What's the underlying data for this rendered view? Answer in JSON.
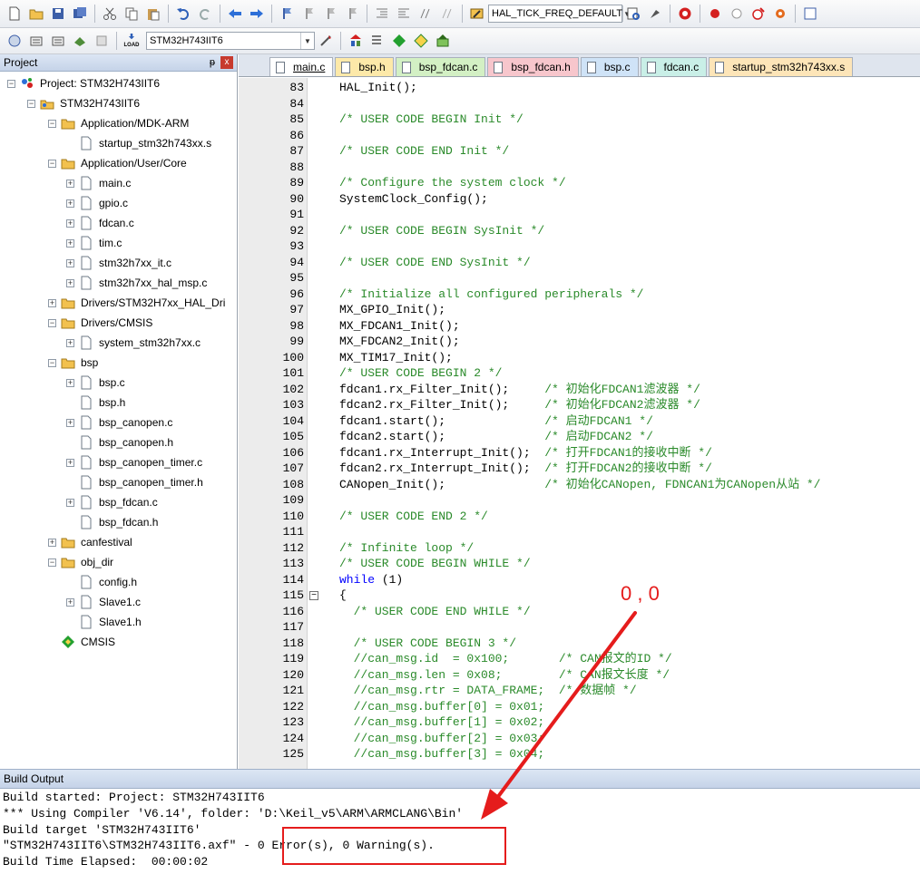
{
  "toolbar": {
    "macro": "HAL_TICK_FREQ_DEFAULT",
    "target": "STM32H743IIT6",
    "load_label": "LOAD"
  },
  "project_panel": {
    "title": "Project",
    "pin": "ᵽ",
    "close": "x",
    "items": [
      {
        "label": "Project: STM32H743IIT6",
        "level": 0,
        "icon": "project-icon",
        "expand": "−"
      },
      {
        "label": "STM32H743IIT6",
        "level": 1,
        "icon": "target-icon",
        "expand": "−"
      },
      {
        "label": "Application/MDK-ARM",
        "level": 2,
        "icon": "folder-icon",
        "expand": "−"
      },
      {
        "label": "startup_stm32h743xx.s",
        "level": 3,
        "icon": "file-icon",
        "expand": ""
      },
      {
        "label": "Application/User/Core",
        "level": 2,
        "icon": "folder-icon",
        "expand": "−"
      },
      {
        "label": "main.c",
        "level": 3,
        "icon": "file-icon",
        "expand": "+"
      },
      {
        "label": "gpio.c",
        "level": 3,
        "icon": "file-icon",
        "expand": "+"
      },
      {
        "label": "fdcan.c",
        "level": 3,
        "icon": "file-icon",
        "expand": "+"
      },
      {
        "label": "tim.c",
        "level": 3,
        "icon": "file-icon",
        "expand": "+"
      },
      {
        "label": "stm32h7xx_it.c",
        "level": 3,
        "icon": "file-icon",
        "expand": "+"
      },
      {
        "label": "stm32h7xx_hal_msp.c",
        "level": 3,
        "icon": "file-icon",
        "expand": "+"
      },
      {
        "label": "Drivers/STM32H7xx_HAL_Dri",
        "level": 2,
        "icon": "folder-icon",
        "expand": "+"
      },
      {
        "label": "Drivers/CMSIS",
        "level": 2,
        "icon": "folder-icon",
        "expand": "−"
      },
      {
        "label": "system_stm32h7xx.c",
        "level": 3,
        "icon": "file-icon",
        "expand": "+"
      },
      {
        "label": "bsp",
        "level": 2,
        "icon": "folder-icon",
        "expand": "−"
      },
      {
        "label": "bsp.c",
        "level": 3,
        "icon": "file-icon",
        "expand": "+"
      },
      {
        "label": "bsp.h",
        "level": 3,
        "icon": "file-icon",
        "expand": ""
      },
      {
        "label": "bsp_canopen.c",
        "level": 3,
        "icon": "file-icon",
        "expand": "+"
      },
      {
        "label": "bsp_canopen.h",
        "level": 3,
        "icon": "file-icon",
        "expand": ""
      },
      {
        "label": "bsp_canopen_timer.c",
        "level": 3,
        "icon": "file-icon",
        "expand": "+"
      },
      {
        "label": "bsp_canopen_timer.h",
        "level": 3,
        "icon": "file-icon",
        "expand": ""
      },
      {
        "label": "bsp_fdcan.c",
        "level": 3,
        "icon": "file-icon",
        "expand": "+"
      },
      {
        "label": "bsp_fdcan.h",
        "level": 3,
        "icon": "file-icon",
        "expand": ""
      },
      {
        "label": "canfestival",
        "level": 2,
        "icon": "folder-icon",
        "expand": "+"
      },
      {
        "label": "obj_dir",
        "level": 2,
        "icon": "folder-icon",
        "expand": "−"
      },
      {
        "label": "config.h",
        "level": 3,
        "icon": "file-icon",
        "expand": ""
      },
      {
        "label": "Slave1.c",
        "level": 3,
        "icon": "file-icon",
        "expand": "+"
      },
      {
        "label": "Slave1.h",
        "level": 3,
        "icon": "file-icon",
        "expand": ""
      },
      {
        "label": "CMSIS",
        "level": 2,
        "icon": "cmsis-icon",
        "expand": ""
      }
    ]
  },
  "tabs": [
    {
      "label": "main.c",
      "active": true,
      "color": "#ffffff"
    },
    {
      "label": "bsp.h",
      "active": false,
      "color": "#fde9a9"
    },
    {
      "label": "bsp_fdcan.c",
      "active": false,
      "color": "#d3f0c4"
    },
    {
      "label": "bsp_fdcan.h",
      "active": false,
      "color": "#f7c6cc"
    },
    {
      "label": "bsp.c",
      "active": false,
      "color": "#cfe3f7"
    },
    {
      "label": "fdcan.c",
      "active": false,
      "color": "#c9efe7"
    },
    {
      "label": "startup_stm32h743xx.s",
      "active": false,
      "color": "#fde5b8"
    }
  ],
  "code_lines": [
    {
      "n": "83",
      "parts": [
        [
          "",
          "HAL_Init();"
        ]
      ]
    },
    {
      "n": "84",
      "parts": []
    },
    {
      "n": "85",
      "parts": [
        [
          "cmt",
          "/* USER CODE BEGIN Init */"
        ]
      ]
    },
    {
      "n": "86",
      "parts": []
    },
    {
      "n": "87",
      "parts": [
        [
          "cmt",
          "/* USER CODE END Init */"
        ]
      ]
    },
    {
      "n": "88",
      "parts": []
    },
    {
      "n": "89",
      "parts": [
        [
          "cmt",
          "/* Configure the system clock */"
        ]
      ]
    },
    {
      "n": "90",
      "parts": [
        [
          "",
          "SystemClock_Config();"
        ]
      ]
    },
    {
      "n": "91",
      "parts": []
    },
    {
      "n": "92",
      "parts": [
        [
          "cmt",
          "/* USER CODE BEGIN SysInit */"
        ]
      ]
    },
    {
      "n": "93",
      "parts": []
    },
    {
      "n": "94",
      "parts": [
        [
          "cmt",
          "/* USER CODE END SysInit */"
        ]
      ]
    },
    {
      "n": "95",
      "parts": []
    },
    {
      "n": "96",
      "parts": [
        [
          "cmt",
          "/* Initialize all configured peripherals */"
        ]
      ]
    },
    {
      "n": "97",
      "parts": [
        [
          "",
          "MX_GPIO_Init();"
        ]
      ]
    },
    {
      "n": "98",
      "parts": [
        [
          "",
          "MX_FDCAN1_Init();"
        ]
      ]
    },
    {
      "n": "99",
      "parts": [
        [
          "",
          "MX_FDCAN2_Init();"
        ]
      ]
    },
    {
      "n": "100",
      "parts": [
        [
          "",
          "MX_TIM17_Init();"
        ]
      ]
    },
    {
      "n": "101",
      "parts": [
        [
          "cmt",
          "/* USER CODE BEGIN 2 */"
        ]
      ]
    },
    {
      "n": "102",
      "parts": [
        [
          "",
          "fdcan1.rx_Filter_Init();     "
        ],
        [
          "cmt",
          "/* 初始化FDCAN1滤波器 */"
        ]
      ]
    },
    {
      "n": "103",
      "parts": [
        [
          "",
          "fdcan2.rx_Filter_Init();     "
        ],
        [
          "cmt",
          "/* 初始化FDCAN2滤波器 */"
        ]
      ]
    },
    {
      "n": "104",
      "parts": [
        [
          "",
          "fdcan1.start();              "
        ],
        [
          "cmt",
          "/* 启动FDCAN1 */"
        ]
      ]
    },
    {
      "n": "105",
      "parts": [
        [
          "",
          "fdcan2.start();              "
        ],
        [
          "cmt",
          "/* 启动FDCAN2 */"
        ]
      ]
    },
    {
      "n": "106",
      "parts": [
        [
          "",
          "fdcan1.rx_Interrupt_Init();  "
        ],
        [
          "cmt",
          "/* 打开FDCAN1的接收中断 */"
        ]
      ]
    },
    {
      "n": "107",
      "parts": [
        [
          "",
          "fdcan2.rx_Interrupt_Init();  "
        ],
        [
          "cmt",
          "/* 打开FDCAN2的接收中断 */"
        ]
      ]
    },
    {
      "n": "108",
      "parts": [
        [
          "",
          "CANopen_Init();              "
        ],
        [
          "cmt",
          "/* 初始化CANopen, FDNCAN1为CANopen从站 */"
        ]
      ]
    },
    {
      "n": "109",
      "parts": []
    },
    {
      "n": "110",
      "parts": [
        [
          "cmt",
          "/* USER CODE END 2 */"
        ]
      ]
    },
    {
      "n": "111",
      "parts": []
    },
    {
      "n": "112",
      "parts": [
        [
          "cmt",
          "/* Infinite loop */"
        ]
      ]
    },
    {
      "n": "113",
      "parts": [
        [
          "cmt",
          "/* USER CODE BEGIN WHILE */"
        ]
      ]
    },
    {
      "n": "114",
      "parts": [
        [
          "kw",
          "while"
        ],
        [
          "",
          " (1)"
        ]
      ]
    },
    {
      "n": "115",
      "parts": [
        [
          "",
          "{"
        ]
      ],
      "fold": "−"
    },
    {
      "n": "116",
      "parts": [
        [
          "cmt",
          "  /* USER CODE END WHILE */"
        ]
      ]
    },
    {
      "n": "117",
      "parts": []
    },
    {
      "n": "118",
      "parts": [
        [
          "cmt",
          "  /* USER CODE BEGIN 3 */"
        ]
      ]
    },
    {
      "n": "119",
      "parts": [
        [
          "cmt",
          "  //can_msg.id  = 0x100;       /* CAN报文的ID */"
        ]
      ]
    },
    {
      "n": "120",
      "parts": [
        [
          "cmt",
          "  //can_msg.len = 0x08;        /* CAN报文长度 */"
        ]
      ]
    },
    {
      "n": "121",
      "parts": [
        [
          "cmt",
          "  //can_msg.rtr = DATA_FRAME;  /* 数据帧 */"
        ]
      ]
    },
    {
      "n": "122",
      "parts": [
        [
          "cmt",
          "  //can_msg.buffer[0] = 0x01;"
        ]
      ]
    },
    {
      "n": "123",
      "parts": [
        [
          "cmt",
          "  //can_msg.buffer[1] = 0x02;"
        ]
      ]
    },
    {
      "n": "124",
      "parts": [
        [
          "cmt",
          "  //can_msg.buffer[2] = 0x03;"
        ]
      ]
    },
    {
      "n": "125",
      "parts": [
        [
          "cmt",
          "  //can_msg.buffer[3] = 0x04;"
        ]
      ]
    }
  ],
  "build_output": {
    "title": "Build Output",
    "lines": [
      "Build started: Project: STM32H743IIT6",
      "*** Using Compiler 'V6.14', folder: 'D:\\Keil_v5\\ARM\\ARMCLANG\\Bin'",
      "Build target 'STM32H743IIT6'",
      "\"STM32H743IIT6\\STM32H743IIT6.axf\" - 0 Error(s), 0 Warning(s).",
      "Build Time Elapsed:  00:00:02"
    ]
  },
  "annotation": {
    "label": "0 , 0",
    "color": "#e51c1c"
  }
}
